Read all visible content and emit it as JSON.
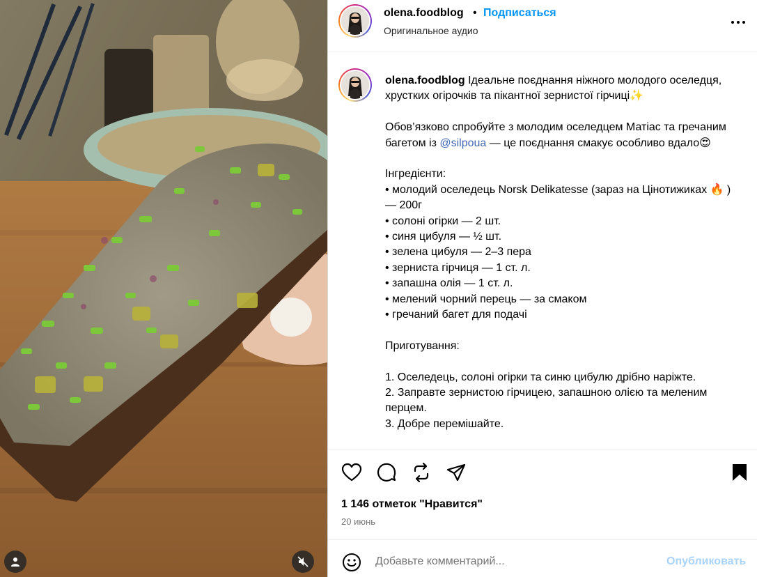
{
  "post": {
    "username": "olena.foodblog",
    "separator": "•",
    "follow_label": "Подписаться",
    "audio_label": "Оригинальное аудио",
    "more_icon": "more-horizontal-icon"
  },
  "caption": {
    "username": "olena.foodblog",
    "lines": [
      "Ідеальне поєднання ніжного молодого оселедця, хрустких огірочків та пікантної зернистої гірчиці✨"
    ],
    "para2_before": "Обов’язково спробуйте з молодим оселедцем Матіас та гречаним багетом із ",
    "mention": "@silpoua",
    "para2_after": " — це поєднання смакує особливо вдало😍",
    "ingredients_title": "Інгредієнти:",
    "ingredients": [
      "• молодий оселедець Norsk Delikatesse (зараз на Цінотижиках 🔥 ) — 200г",
      "• солоні огірки — 2 шт.",
      "• синя цибуля — ½ шт.",
      "• зелена цибуля — 2–3 пера",
      "• зерниста гірчиця — 1 ст. л.",
      "• запашна олія — 1 ст. л.",
      "• мелений чорний перець — за смаком",
      "• гречаний багет для подачі"
    ],
    "steps_title": "Приготування:",
    "steps": [
      "1. Оселедець, солоні огірки та синю цибулю дрібно наріжте.",
      "2. Заправте зернистою гірчицею, запашною олією та меленим перцем.",
      "3. Добре перемішайте."
    ]
  },
  "actions": {
    "likes_text": "1 146 отметок \"Нравится\"",
    "date": "20 июнь",
    "icons": [
      "heart-icon",
      "comment-icon",
      "repost-icon",
      "share-icon",
      "bookmark-icon"
    ]
  },
  "comment": {
    "placeholder": "Добавьте комментарий...",
    "publish_label": "Опубликовать"
  },
  "colors": {
    "link": "#0095f6",
    "publish_disabled": "#a8d3fb",
    "secondary_text": "#737373"
  }
}
